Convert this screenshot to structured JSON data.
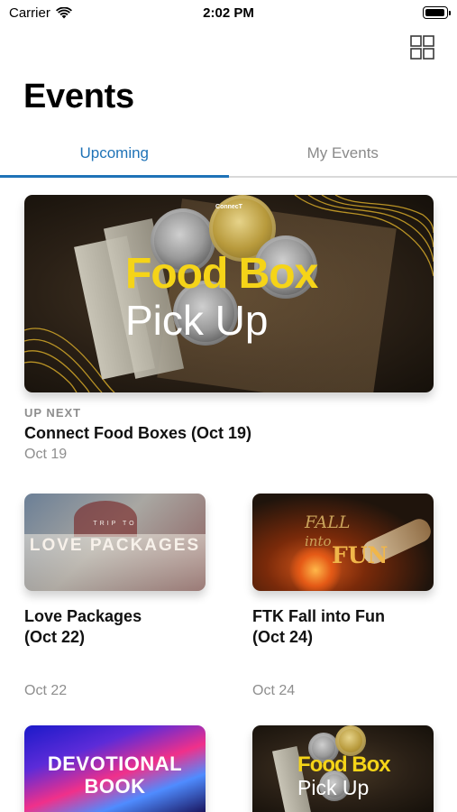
{
  "status_bar": {
    "carrier": "Carrier",
    "time": "2:02 PM"
  },
  "header": {
    "title": "Events",
    "grid_icon": "grid-view-icon"
  },
  "tabs": [
    {
      "label": "Upcoming",
      "active": true
    },
    {
      "label": "My Events",
      "active": false
    }
  ],
  "accent_color": "#1f73b7",
  "featured": {
    "kicker": "UP NEXT",
    "title": "Connect  Food Boxes (Oct 19)",
    "date": "Oct 19",
    "art": {
      "line1": "Food Box",
      "line2": "Pick Up",
      "logo": "ConnecT"
    }
  },
  "events": [
    {
      "title": "Love Packages\n(Oct 22)",
      "date": "Oct 22",
      "art": {
        "small": "TRIP TO",
        "main": "LOVE PACKAGES"
      }
    },
    {
      "title": "FTK Fall into Fun\n(Oct 24)",
      "date": "Oct 24",
      "art": {
        "line1": "FALL",
        "line2": "into",
        "line3": "FUN"
      }
    },
    {
      "art": {
        "line1": "DEVOTIONAL",
        "line2": "BOOK"
      }
    },
    {
      "art": {
        "line1": "Food Box",
        "line2": "Pick Up"
      }
    }
  ]
}
